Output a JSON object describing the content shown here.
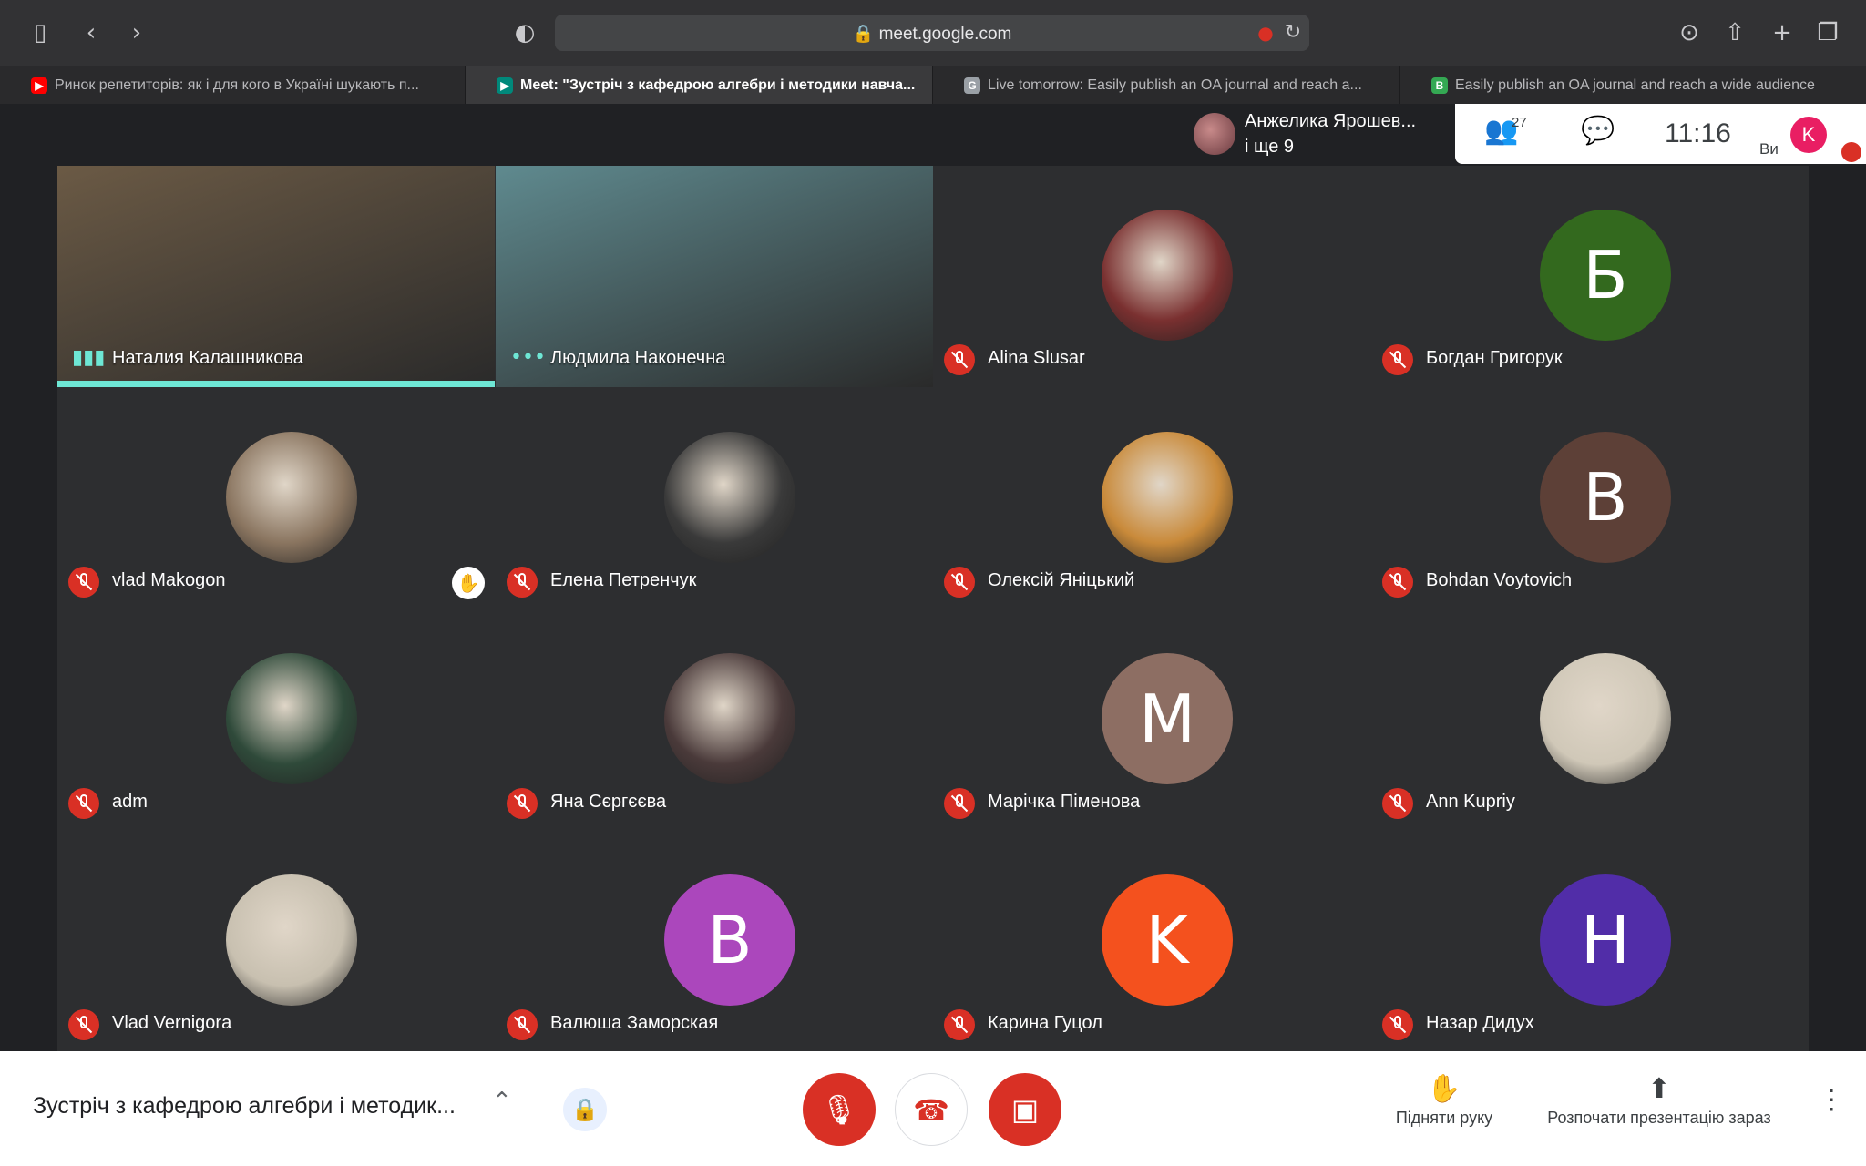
{
  "browser": {
    "url": "meet.google.com",
    "tabs": [
      {
        "label": "Ринок репетиторів: як і для кого в Україні шукають п...",
        "favicon": "youtube-icon",
        "color": "#ff0000",
        "active": false
      },
      {
        "label": "Meet: \"Зустріч з кафедрою алгебри і методики навча...",
        "favicon": "meet-icon",
        "color": "#00897b",
        "active": true
      },
      {
        "label": "Live tomorrow: Easily publish an OA journal and reach a...",
        "favicon": "g-icon",
        "color": "#9aa0a6",
        "fav_letter": "G",
        "active": false
      },
      {
        "label": "Easily publish an OA journal and reach a wide audience",
        "favicon": "b-icon",
        "color": "#34a853",
        "fav_letter": "B",
        "active": false
      }
    ]
  },
  "meet": {
    "overflow": {
      "line1": "Анжелика Ярошев...",
      "line2": "і ще 9"
    },
    "people_count": "27",
    "time": "11:16",
    "self_initial": "K",
    "self_label": "Ви",
    "participants": [
      {
        "name": "Наталия Калашникова",
        "type": "video",
        "speaking": true,
        "bg": "#6b5a45"
      },
      {
        "name": "Людмила Наконечна",
        "type": "video",
        "bg": "#5f8a8f"
      },
      {
        "name": "Alina Slusar",
        "type": "photo",
        "bg": "#7a3030"
      },
      {
        "name": "Богдан Григорук",
        "type": "letter",
        "initial": "Б",
        "color": "#33691e"
      },
      {
        "name": "vlad Makogon",
        "type": "photo",
        "bg": "#8a7560"
      },
      {
        "name": "Елена Петренчук",
        "type": "photo",
        "bg": "#3a3a3a",
        "hand": true
      },
      {
        "name": "Олексій Яніцький",
        "type": "photo",
        "bg": "#c98a3a"
      },
      {
        "name": "Bohdan Voytovich",
        "type": "letter",
        "initial": "B",
        "color": "#5d4037"
      },
      {
        "name": "adm",
        "type": "photo",
        "bg": "#2f4a3a"
      },
      {
        "name": "Яна Сєргєєва",
        "type": "photo",
        "bg": "#4a3a3a"
      },
      {
        "name": "Марічка Піменова",
        "type": "letter",
        "initial": "M",
        "color": "#8d6e63"
      },
      {
        "name": "Ann Kupriy",
        "type": "photo",
        "bg": "#d0c8b8"
      },
      {
        "name": "Vlad Vernigora",
        "type": "photo",
        "bg": "#c8c0b0"
      },
      {
        "name": "Валюша Заморская",
        "type": "letter",
        "initial": "B",
        "color": "#ab47bc"
      },
      {
        "name": "Карина Гуцол",
        "type": "letter",
        "initial": "K",
        "color": "#f4511e"
      },
      {
        "name": "Назар Дидух",
        "type": "letter",
        "initial": "H",
        "color": "#512da8"
      }
    ]
  },
  "bottom": {
    "meeting_title": "Зустріч з кафедрою алгебри і методик...",
    "raise_hand": "Підняти руку",
    "present": "Розпочати презентацію зараз"
  }
}
